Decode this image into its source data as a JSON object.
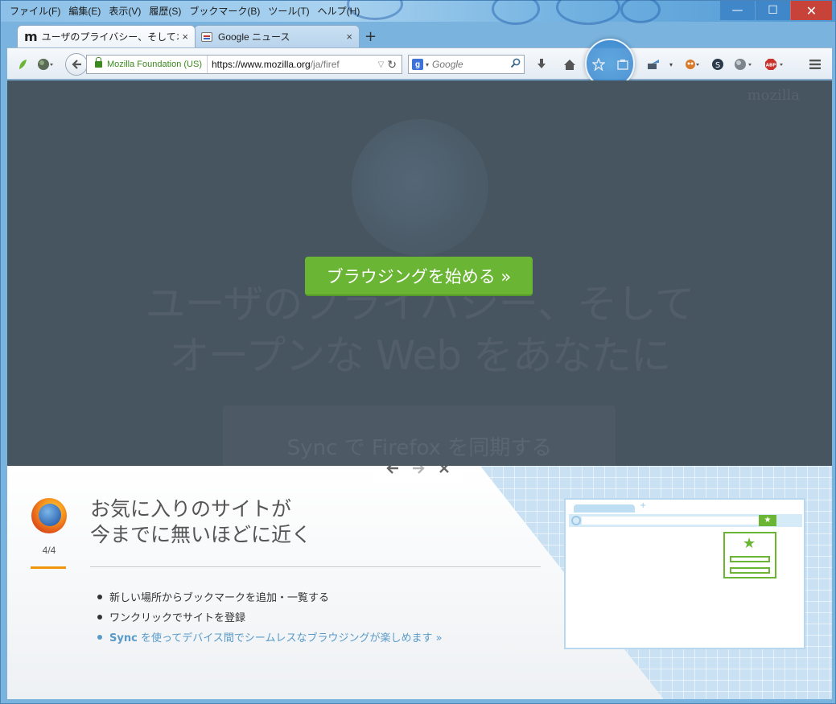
{
  "menubar": {
    "items": [
      "ファイル(F)",
      "編集(E)",
      "表示(V)",
      "履歴(S)",
      "ブックマーク(B)",
      "ツール(T)",
      "ヘルプ(H)"
    ]
  },
  "window_controls": {
    "minimize": "—",
    "maximize": "☐",
    "close": "✕"
  },
  "tabs": [
    {
      "label": "ユーザのプライバシー、そしてオ...",
      "favicon": "mozilla-m-icon",
      "active": true
    },
    {
      "label": "Google ニュース",
      "favicon": "google-news-icon",
      "active": false
    }
  ],
  "tab_close": "×",
  "new_tab": "+",
  "navbar": {
    "identity": "Mozilla Foundation (US)",
    "url_host": "https://www.mozilla.org",
    "url_path": "/ja/firef",
    "search_engine": "g",
    "search_placeholder": "Google"
  },
  "content": {
    "wordmark": "mozilla",
    "heading_line1": "ユーザのプライバシー、そして",
    "heading_line2": "オープンな Web をあなたに",
    "sync_text": "Sync で Firefox を同期する",
    "cta_label": "ブラウジングを始める »"
  },
  "tour": {
    "progress": "4/4",
    "title_line1": "お気に入りのサイトが",
    "title_line2": "今までに無いほどに近く",
    "bullets": [
      "新しい場所からブックマークを追加・一覧する",
      "ワンクリックでサイトを登録"
    ],
    "sync_link_bold": "Sync",
    "sync_link_rest": " を使ってデバイス間でシームレスなブラウジングが楽しめます »"
  },
  "colors": {
    "accent_green": "#6ab534",
    "overlay": "#475560",
    "progress_orange": "#f0960e",
    "link_blue": "#5a9ac8"
  }
}
